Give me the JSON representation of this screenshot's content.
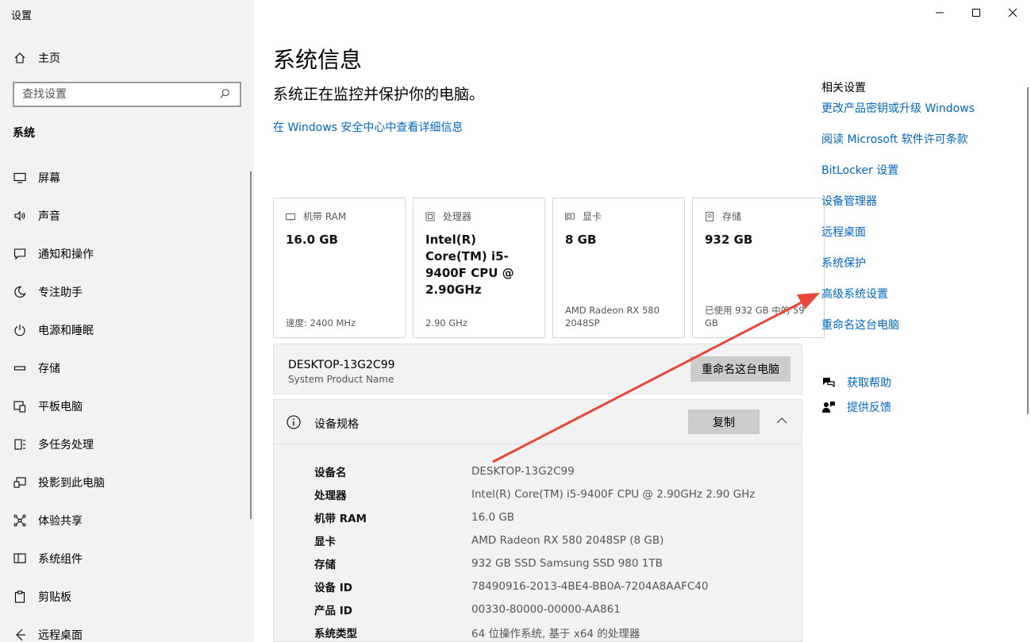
{
  "app": {
    "title": "设置"
  },
  "sidebar": {
    "home_label": "主页",
    "search_placeholder": "查找设置",
    "section_title": "系统",
    "items": [
      {
        "label": "屏幕",
        "icon": "monitor-icon"
      },
      {
        "label": "声音",
        "icon": "speaker-icon"
      },
      {
        "label": "通知和操作",
        "icon": "notification-icon"
      },
      {
        "label": "专注助手",
        "icon": "moon-icon"
      },
      {
        "label": "电源和睡眠",
        "icon": "power-icon"
      },
      {
        "label": "存储",
        "icon": "storage-icon"
      },
      {
        "label": "平板电脑",
        "icon": "tablet-icon"
      },
      {
        "label": "多任务处理",
        "icon": "multitask-icon"
      },
      {
        "label": "投影到此电脑",
        "icon": "project-icon"
      },
      {
        "label": "体验共享",
        "icon": "share-icon"
      },
      {
        "label": "系统组件",
        "icon": "components-icon"
      },
      {
        "label": "剪贴板",
        "icon": "clipboard-icon"
      },
      {
        "label": "远程桌面",
        "icon": "remote-icon"
      }
    ]
  },
  "main": {
    "title": "系统信息",
    "subtitle": "系统正在监控并保护你的电脑。",
    "security_link": "在 Windows 安全中心中查看详细信息",
    "cards": [
      {
        "label": "机带 RAM",
        "value": "16.0 GB",
        "sub": "速度: 2400 MHz",
        "icon": "ram-icon"
      },
      {
        "label": "处理器",
        "value": "Intel(R) Core(TM) i5-9400F CPU @ 2.90GHz",
        "sub": "2.90 GHz",
        "icon": "cpu-icon"
      },
      {
        "label": "显卡",
        "value": "8 GB",
        "sub": "AMD Radeon RX 580 2048SP",
        "icon": "gpu-icon"
      },
      {
        "label": "存储",
        "value": "932 GB",
        "sub": "已使用 932 GB 中的 59 GB",
        "icon": "disk-icon"
      }
    ],
    "device": {
      "name": "DESKTOP-13G2C99",
      "product_name": "System Product Name",
      "rename_label": "重命名这台电脑"
    },
    "specs": {
      "title": "设备规格",
      "copy_label": "复制",
      "rows": [
        {
          "key": "设备名",
          "value": "DESKTOP-13G2C99"
        },
        {
          "key": "处理器",
          "value": "Intel(R) Core(TM) i5-9400F CPU @ 2.90GHz   2.90 GHz"
        },
        {
          "key": "机带 RAM",
          "value": "16.0 GB"
        },
        {
          "key": "显卡",
          "value": "AMD Radeon RX 580 2048SP (8 GB)"
        },
        {
          "key": "存储",
          "value": "932 GB SSD Samsung SSD 980 1TB"
        },
        {
          "key": "设备 ID",
          "value": "78490916-2013-4BE4-BB0A-7204A8AAFC40"
        },
        {
          "key": "产品 ID",
          "value": "00330-80000-00000-AA861"
        },
        {
          "key": "系统类型",
          "value": "64 位操作系统, 基于 x64 的处理器"
        }
      ]
    }
  },
  "related": {
    "title": "相关设置",
    "links": [
      "更改产品密钥或升级 Windows",
      "阅读 Microsoft 软件许可条款",
      "BitLocker 设置",
      "设备管理器",
      "远程桌面",
      "系统保护",
      "高级系统设置",
      "重命名这台电脑"
    ],
    "help": [
      {
        "label": "获取帮助",
        "icon": "help-chat-icon"
      },
      {
        "label": "提供反馈",
        "icon": "feedback-icon"
      }
    ]
  },
  "colors": {
    "link": "#0067c0",
    "annotation_arrow": "#e8473a",
    "sidebar_bg": "#f2f2f2"
  }
}
